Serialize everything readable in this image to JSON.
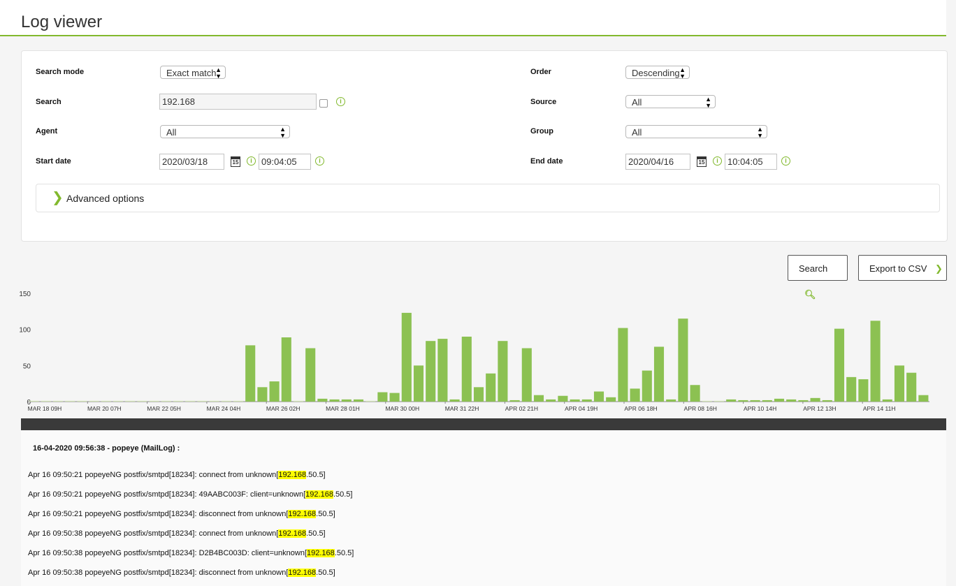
{
  "header": {
    "title": "Log viewer"
  },
  "form": {
    "search_mode_label": "Search mode",
    "search_mode_value": "Exact match",
    "order_label": "Order",
    "order_value": "Descending",
    "search_label": "Search",
    "search_value": "192.168",
    "source_label": "Source",
    "source_value": "All",
    "agent_label": "Agent",
    "agent_value": "All",
    "group_label": "Group",
    "group_value": "All",
    "start_label": "Start date",
    "start_date": "2020/03/18",
    "start_time": "09:04:05",
    "end_label": "End date",
    "end_date": "2020/04/16",
    "end_time": "10:04:05",
    "calendar_day": "15",
    "advanced_label": "Advanced options"
  },
  "buttons": {
    "search_label": "Search",
    "export_label": "Export to CSV"
  },
  "chart_data": {
    "type": "bar",
    "color": "#8cc152",
    "ylim": [
      0,
      150
    ],
    "yticks": [
      0,
      50,
      100,
      150
    ],
    "x_tick_labels": [
      "Mar 18 09h",
      "Mar 20 07h",
      "Mar 22 05h",
      "Mar 24 04h",
      "Mar 26 02h",
      "Mar 28 01h",
      "Mar 30 00h",
      "Mar 31 22h",
      "Apr 02 21h",
      "Apr 04 19h",
      "Apr 06 18h",
      "Apr 08 16h",
      "Apr 10 14h",
      "Apr 12 13h",
      "Apr 14 11h"
    ],
    "values": [
      1,
      1,
      1,
      1,
      1,
      1,
      1,
      1,
      1,
      1,
      1,
      1,
      1,
      1,
      1,
      1,
      1,
      1,
      78,
      20,
      28,
      89,
      1,
      74,
      4,
      3,
      3,
      3,
      1,
      13,
      12,
      123,
      50,
      84,
      87,
      3,
      90,
      20,
      39,
      84,
      2,
      74,
      9,
      3,
      8,
      3,
      3,
      14,
      6,
      102,
      18,
      43,
      76,
      3,
      115,
      23,
      1,
      1,
      3,
      2,
      2,
      2,
      4,
      3,
      2,
      5,
      2,
      101,
      34,
      31,
      112,
      3,
      50,
      40,
      9
    ]
  },
  "log": {
    "header": "16-04-2020 09:56:38 - popeye (MailLog) :",
    "highlight": "192.168",
    "lines": [
      {
        "pre": "Apr 16 09:50:21 popeyeNG postfix/smtpd[18234]: connect from unknown[",
        "post": ".50.5]"
      },
      {
        "pre": "Apr 16 09:50:21 popeyeNG postfix/smtpd[18234]: 49AABC003F: client=unknown[",
        "post": ".50.5]"
      },
      {
        "pre": "Apr 16 09:50:21 popeyeNG postfix/smtpd[18234]: disconnect from unknown[",
        "post": ".50.5]"
      },
      {
        "pre": "Apr 16 09:50:38 popeyeNG postfix/smtpd[18234]: connect from unknown[",
        "post": ".50.5]"
      },
      {
        "pre": "Apr 16 09:50:38 popeyeNG postfix/smtpd[18234]: D2B4BC003D: client=unknown[",
        "post": ".50.5]"
      },
      {
        "pre": "Apr 16 09:50:38 popeyeNG postfix/smtpd[18234]: disconnect from unknown[",
        "post": ".50.5]"
      }
    ]
  }
}
